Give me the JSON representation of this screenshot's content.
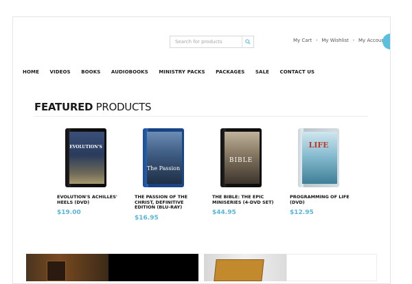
{
  "header": {
    "search_placeholder": "Search for products",
    "links": [
      "My Cart",
      "My Wishlist",
      "My Account"
    ],
    "separator": "•",
    "accent_color": "#5bc0de"
  },
  "nav": {
    "items": [
      "HOME",
      "VIDEOS",
      "BOOKS",
      "AUDIOBOOKS",
      "MINISTRY PACKS",
      "PACKAGES",
      "SALE",
      "CONTACT US"
    ]
  },
  "featured": {
    "title_bold": "FEATURED",
    "title_rest": "PRODUCTS"
  },
  "products": [
    {
      "title": "EVOLUTION'S ACHILLES' HEELS (DVD)",
      "price": "$19.00",
      "cover_text": "EVOLUTION'S"
    },
    {
      "title": "THE PASSION OF THE CHRIST, DEFINITIVE EDITION (BLU-RAY)",
      "price": "$16.95",
      "cover_text": "The Passion"
    },
    {
      "title": "THE BIBLE: THE EPIC MINISERIES (4-DVD SET)",
      "price": "$44.95",
      "cover_text": "BIBLE"
    },
    {
      "title": "PROGRAMMING OF LIFE (DVD)",
      "price": "$12.95",
      "cover_text": "LIFE"
    }
  ],
  "price_color": "#5bb5d6"
}
